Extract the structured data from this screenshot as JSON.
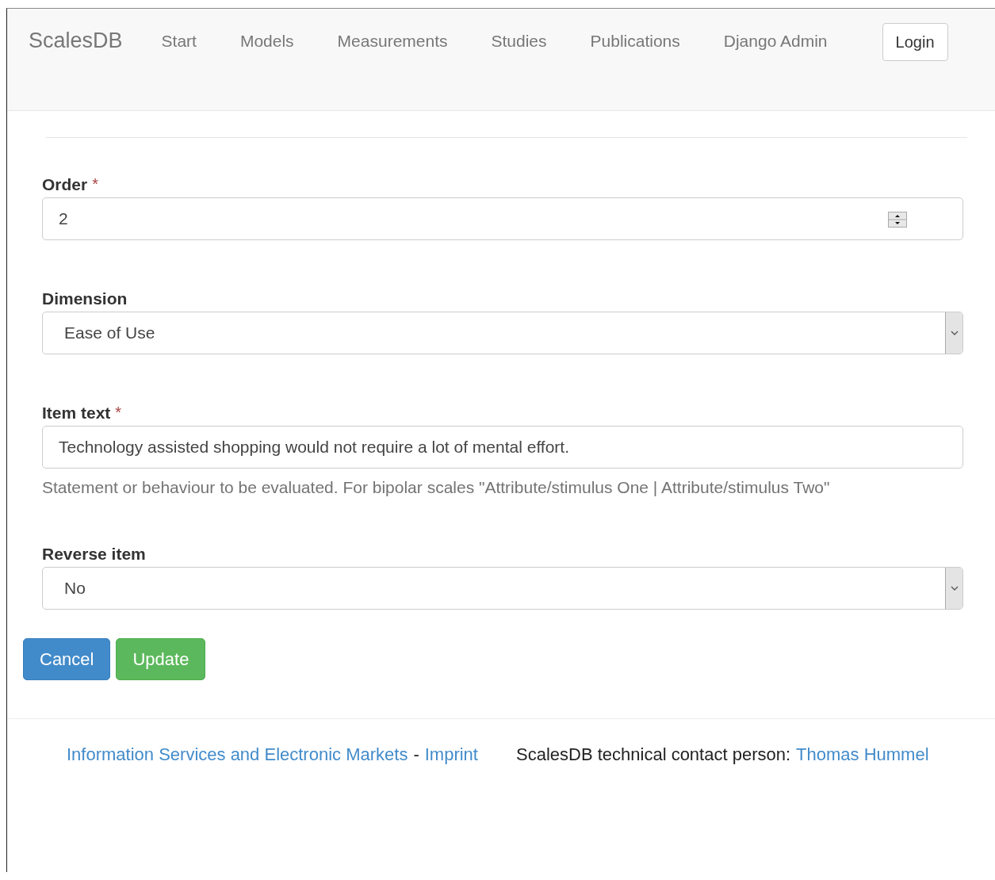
{
  "navbar": {
    "brand": "ScalesDB",
    "items": [
      "Start",
      "Models",
      "Measurements",
      "Studies",
      "Publications",
      "Django Admin"
    ],
    "login": "Login"
  },
  "form": {
    "fields": [
      {
        "kind": "number",
        "label": "Order",
        "required_mark": "*",
        "value": "2"
      },
      {
        "kind": "select",
        "label": "Dimension",
        "value": "Ease of Use"
      },
      {
        "kind": "text",
        "label": "Item text",
        "required_mark": "*",
        "value": "Technology assisted shopping would not require a lot of mental effort.",
        "help": "Statement or behaviour to be evaluated. For bipolar scales \"Attribute/stimulus One | Attribute/stimulus Two\""
      },
      {
        "kind": "select",
        "label": "Reverse item",
        "value": "No"
      }
    ],
    "buttons": [
      {
        "kind": "primary",
        "label": "Cancel"
      },
      {
        "kind": "success",
        "label": "Update"
      }
    ]
  },
  "footer": {
    "left": [
      {
        "kind": "link",
        "text": "Information Services and Electronic Markets"
      },
      {
        "kind": "text",
        "text": "-"
      },
      {
        "kind": "link",
        "text": "Imprint"
      }
    ],
    "right": [
      {
        "kind": "text",
        "text": "ScalesDB technical contact person:"
      },
      {
        "kind": "link",
        "text": "Thomas Hummel"
      }
    ]
  }
}
